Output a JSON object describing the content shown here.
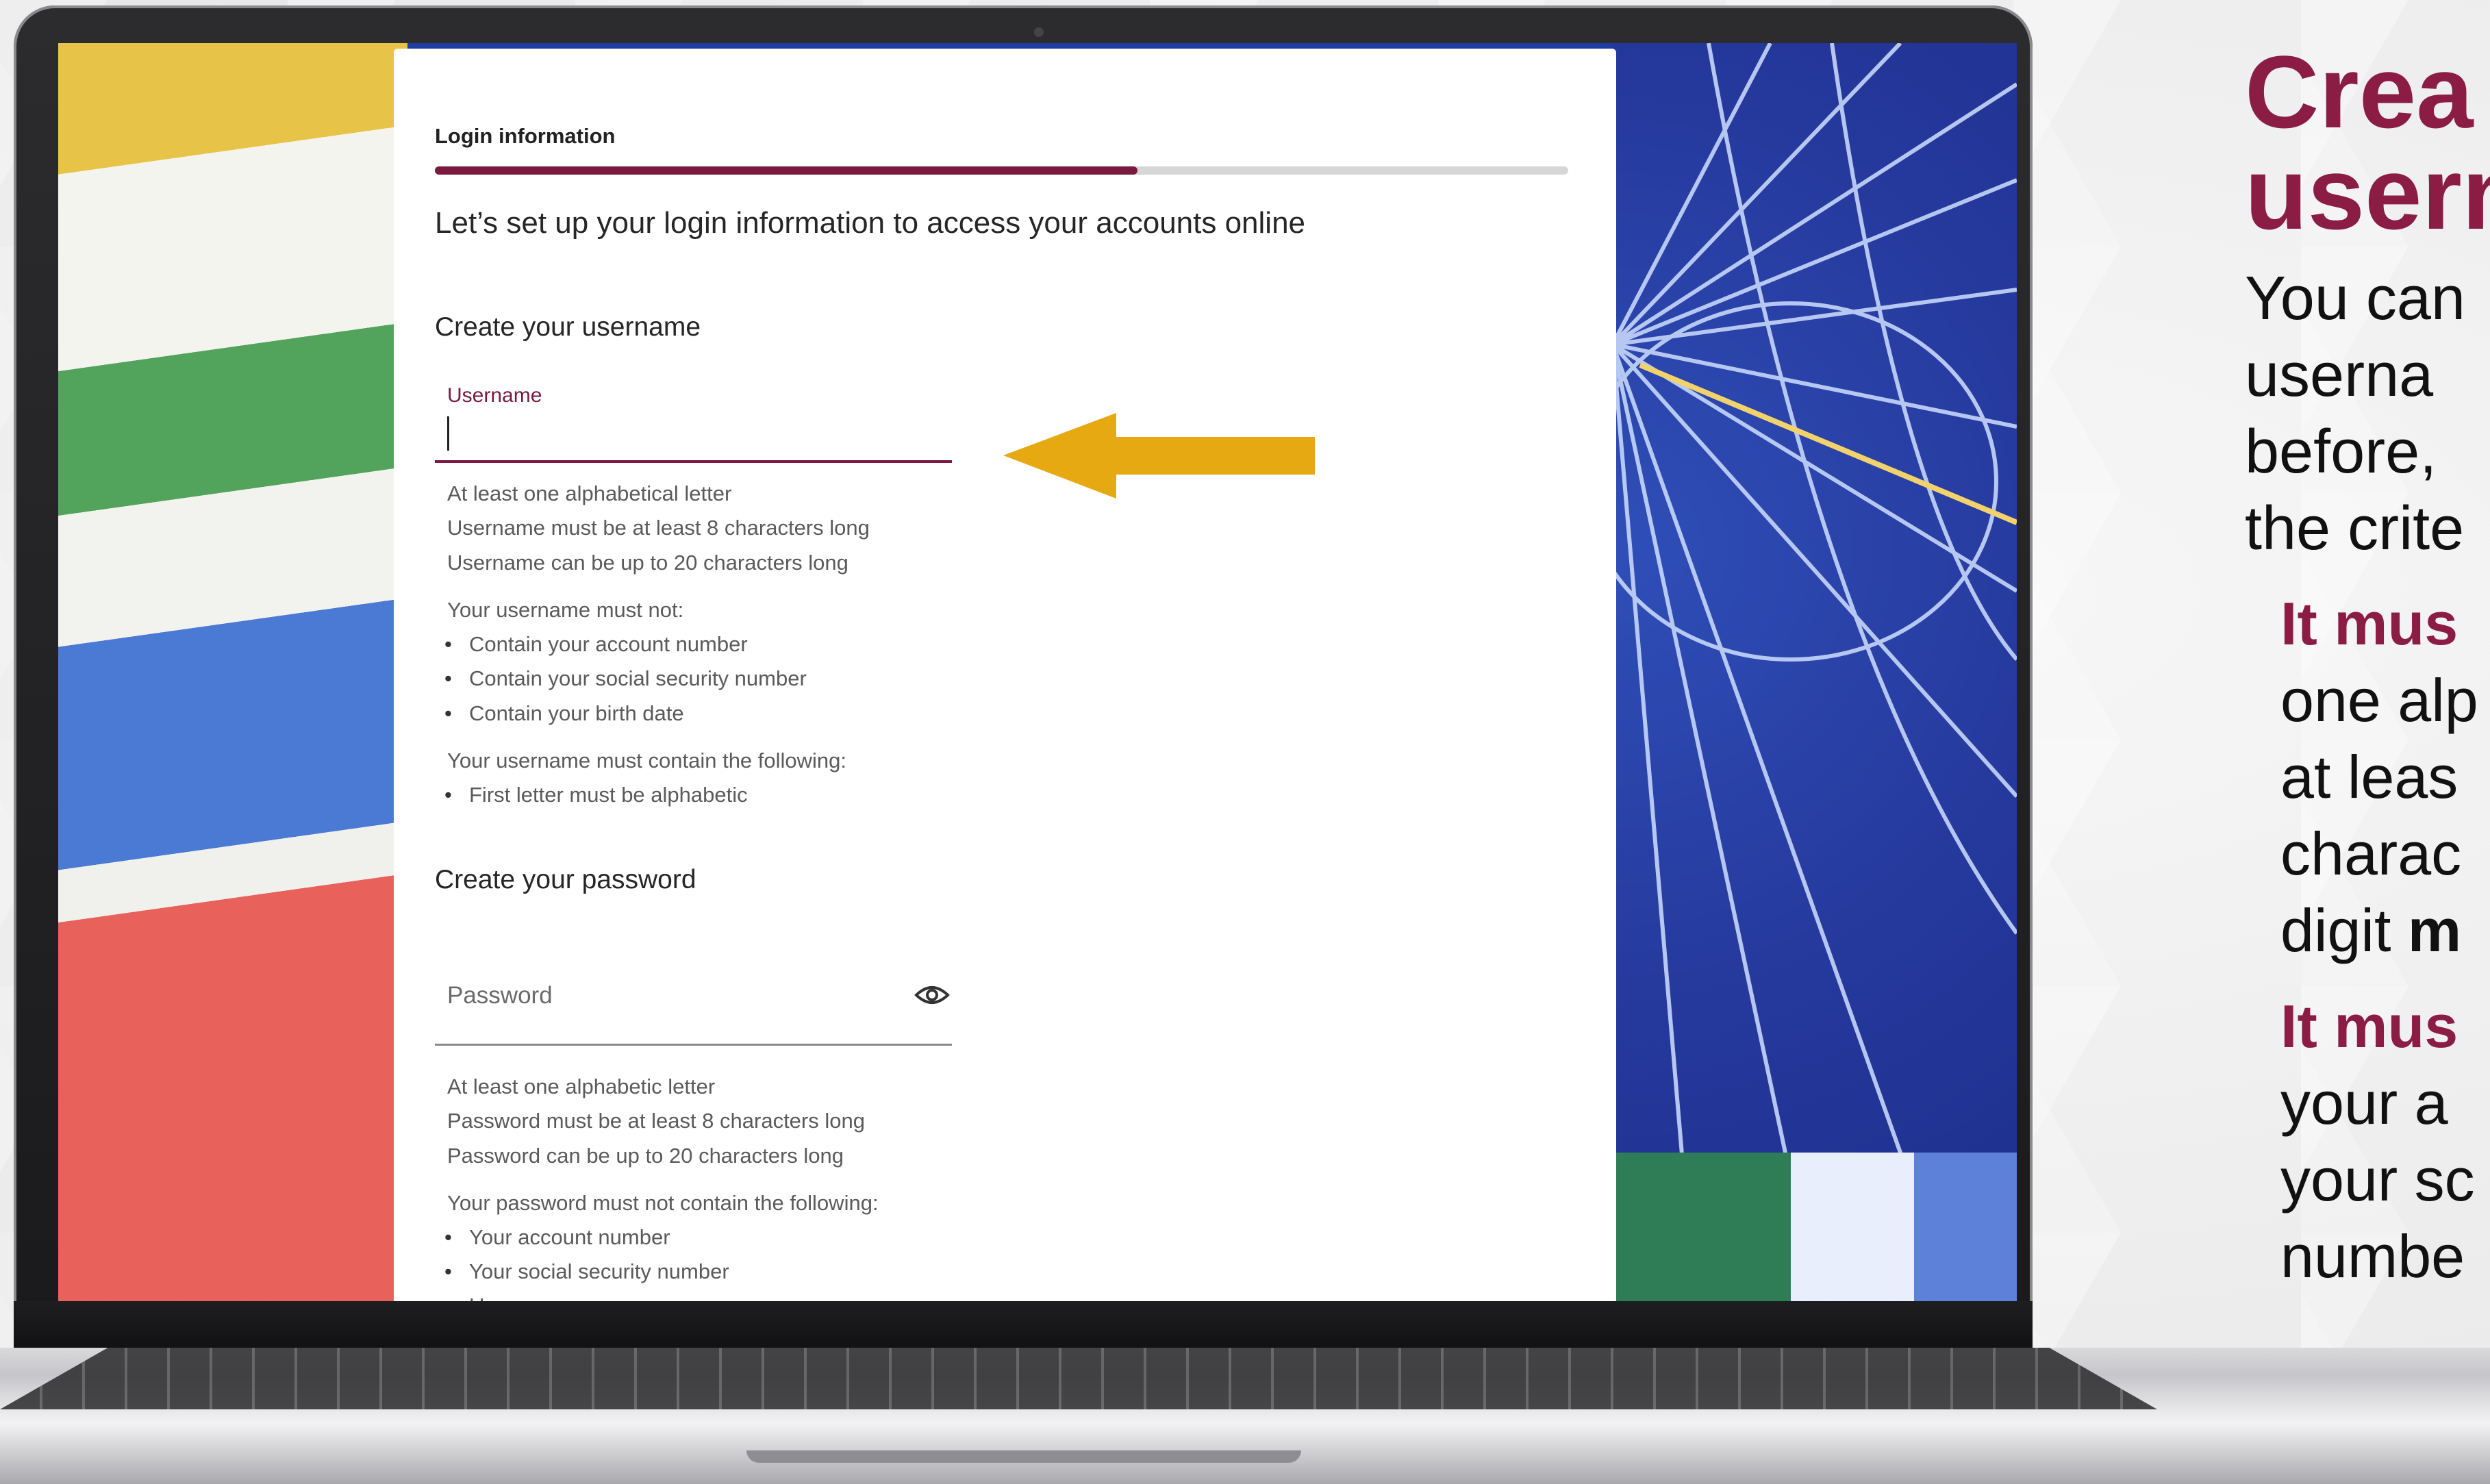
{
  "form": {
    "step_title": "Login information",
    "progress_percent": 62,
    "intro": "Let’s set up your login information to access your accounts online",
    "username_section_title": "Create your username",
    "username_label": "Username",
    "username_value": "",
    "username_hints": [
      "At least one alphabetical letter",
      "Username must be at least 8 characters long",
      "Username can be up to 20 characters long"
    ],
    "username_must_not_title": "Your username must not:",
    "username_must_not": [
      "Contain your account number",
      "Contain your social security number",
      "Contain your birth date"
    ],
    "username_must_contain_title": "Your username must contain the following:",
    "username_must_contain": [
      "First letter must be alphabetic"
    ],
    "password_section_title": "Create your password",
    "password_placeholder": "Password",
    "password_hints": [
      "At least one alphabetic letter",
      "Password must be at least 8 characters long",
      "Password can be up to 20 characters long"
    ],
    "password_must_not_title": "Your password must not contain the following:",
    "password_must_not": [
      "Your account number",
      "Your social security number",
      "Username"
    ]
  },
  "callout": {
    "title_line1": "Crea",
    "title_line2": "usern",
    "body_lines": [
      "You can",
      "userna",
      "before,",
      "the crite"
    ],
    "item1_lead": "It mus",
    "item1_lines": [
      "one alp",
      "at leas",
      "charac"
    ],
    "item1_last_plain": "digit ",
    "item1_last_bold": "m",
    "item2_lead": "It mus",
    "item2_lines": [
      "your a",
      "your sc",
      "numbe"
    ]
  },
  "colors": {
    "brand": "#7a1a3f",
    "arrow": "#e6a911",
    "callout_accent": "#8b1d45"
  }
}
